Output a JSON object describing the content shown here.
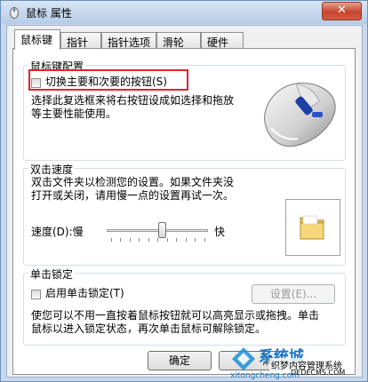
{
  "window": {
    "title": "鼠标 属性",
    "close_label": "✕"
  },
  "tabs": [
    {
      "label": "鼠标键",
      "active": true
    },
    {
      "label": "指针"
    },
    {
      "label": "指针选项"
    },
    {
      "label": "滑轮"
    },
    {
      "label": "硬件"
    }
  ],
  "button_config": {
    "group_label": "鼠标键配置",
    "checkbox_label": "切换主要和次要的按钮(S)",
    "checked": false,
    "description_lines": [
      "选择此复选框来将右按钮设成如选择和拖放",
      "等主要性能使用。"
    ]
  },
  "double_click": {
    "group_label": "双击速度",
    "description_lines": [
      "双击文件夹以检测您的设置。如果文件夹没",
      "打开或关闭，请用慢一点的设置再试一次。"
    ],
    "speed_label": "速度(D):慢",
    "fast_label": "快",
    "speed_fraction": 0.55
  },
  "click_lock": {
    "group_label": "单击锁定",
    "checkbox_label": "启用单击锁定(T)",
    "checked": false,
    "settings_button": "设置(E)...",
    "description_lines": [
      "使您可以不用一直按着鼠标按钮就可以高亮显示或拖拽。单击",
      "鼠标以进入锁定状态，再次单击鼠标可解除锁定。"
    ]
  },
  "footer": {
    "ok_label": "确定",
    "cancel_partial": "消"
  },
  "watermark": {
    "brand": "系统城",
    "site_cn": "织梦内容管理系统",
    "site_en": "DEDECMS.COM",
    "url": "xitongcheng.com"
  },
  "colors": {
    "highlight": "#e2232a",
    "title_bar": "#c8d9ee",
    "close_button": "#c7452e"
  }
}
